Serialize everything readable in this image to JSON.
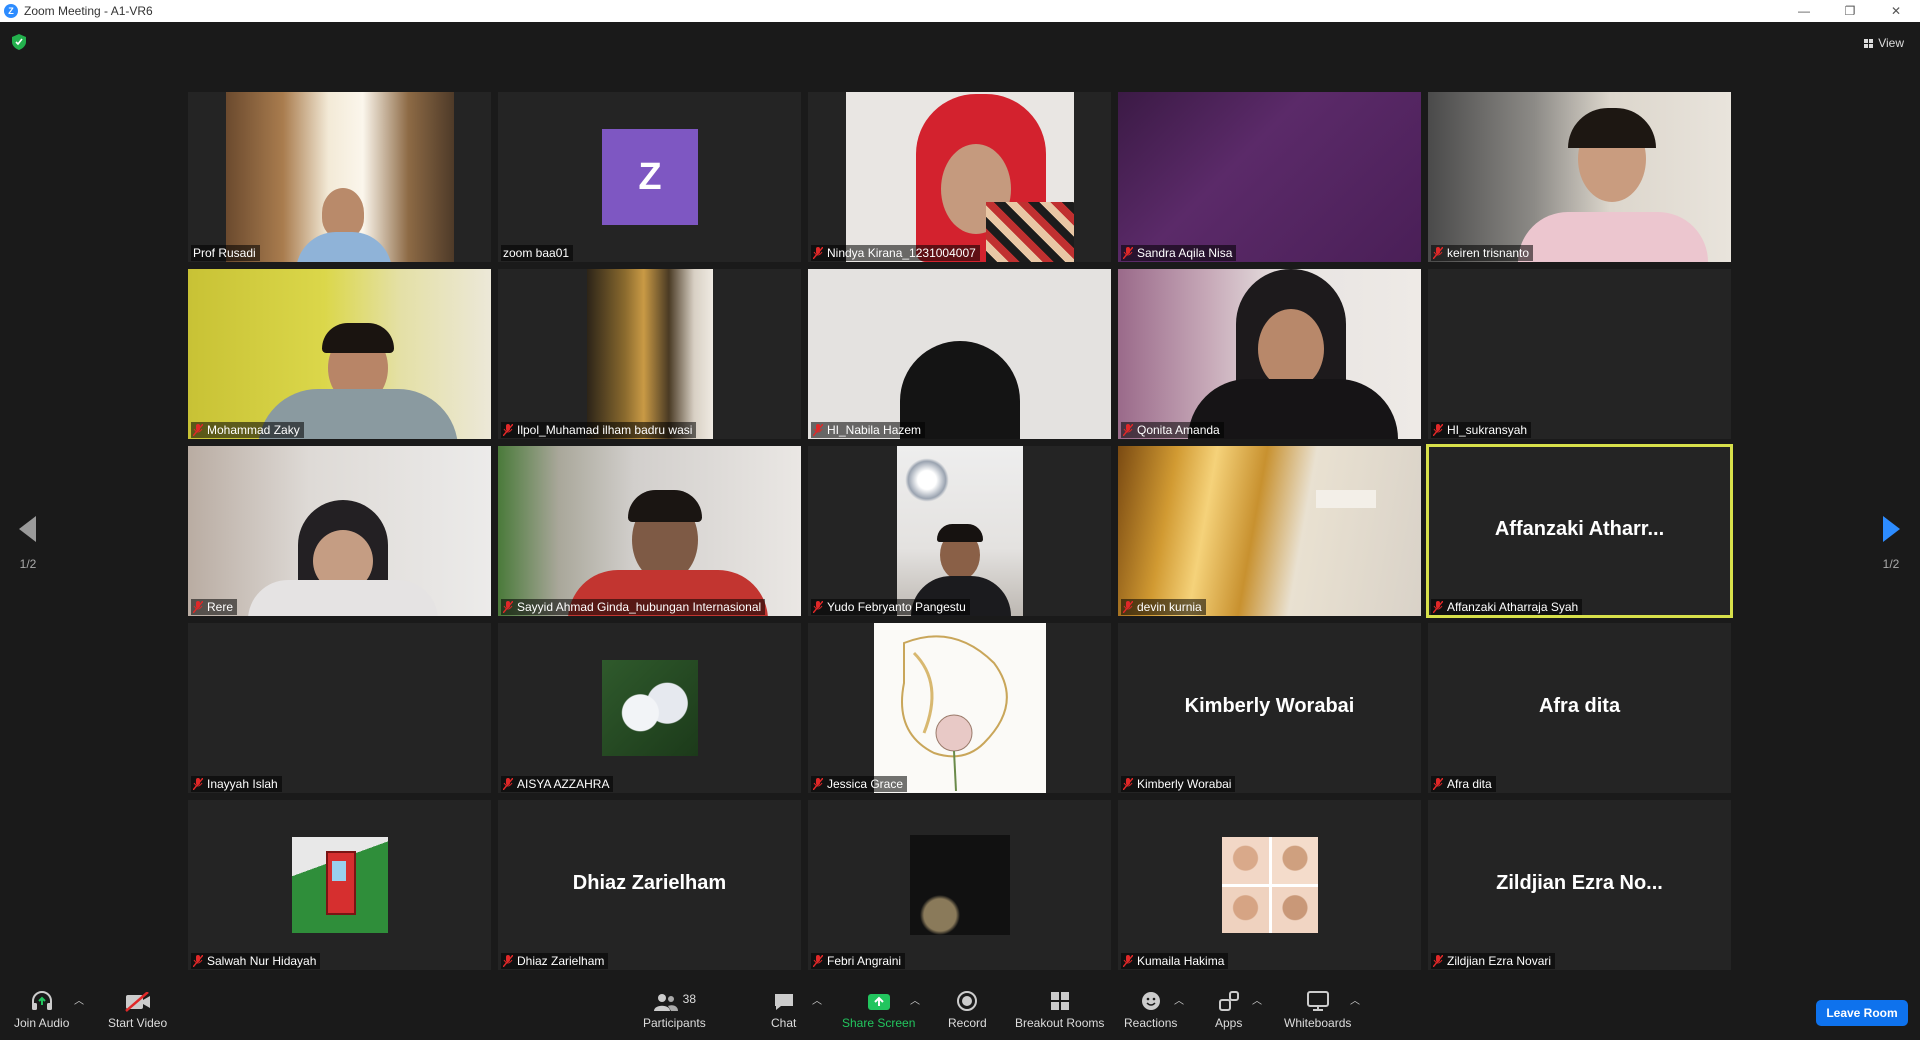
{
  "window": {
    "title": "Zoom Meeting - A1-VR6",
    "minimize": "—",
    "restore": "❐",
    "close": "✕"
  },
  "header": {
    "view_label": "View"
  },
  "paging": {
    "left": "1/2",
    "right": "1/2"
  },
  "participants": [
    {
      "name": "Prof Rusadi",
      "muted": false,
      "video": true
    },
    {
      "name": "zoom baa01",
      "muted": false,
      "video": false,
      "avatar_letter": "Z"
    },
    {
      "name": "Nindya Kirana_1231004007",
      "muted": true,
      "video": true
    },
    {
      "name": "Sandra Aqila Nisa",
      "muted": true,
      "video": true
    },
    {
      "name": "keiren trisnanto",
      "muted": true,
      "video": true
    },
    {
      "name": "Mohammad Zaky",
      "muted": true,
      "video": true
    },
    {
      "name": "Ilpol_Muhamad ilham badru wasi",
      "muted": true,
      "video": true
    },
    {
      "name": "HI_Nabila Hazem",
      "muted": true,
      "video": true
    },
    {
      "name": "Qonita Amanda",
      "muted": true,
      "video": true
    },
    {
      "name": "HI_sukransyah",
      "muted": true,
      "video": false
    },
    {
      "name": "Rere",
      "muted": true,
      "video": true
    },
    {
      "name": "Sayyid Ahmad Ginda_hubungan Internasional",
      "muted": true,
      "video": true
    },
    {
      "name": "Yudo Febryanto Pangestu",
      "muted": true,
      "video": true
    },
    {
      "name": "devin kurnia",
      "muted": true,
      "video": true
    },
    {
      "name": "Affanzaki Atharraja Syah",
      "muted": true,
      "video": false,
      "display_name": "Affanzaki  Atharr...",
      "active_speaker": true
    },
    {
      "name": "Inayyah Islah",
      "muted": true,
      "video": false
    },
    {
      "name": "AISYA AZZAHRA",
      "muted": true,
      "video": false,
      "profile_pic": "flowers"
    },
    {
      "name": "Jessica Grace",
      "muted": true,
      "video": true
    },
    {
      "name": "Kimberly Worabai",
      "muted": true,
      "video": false,
      "display_name": "Kimberly Worabai"
    },
    {
      "name": "Afra dita",
      "muted": true,
      "video": false,
      "display_name": "Afra dita"
    },
    {
      "name": "Salwah Nur Hidayah",
      "muted": true,
      "video": false,
      "profile_pic": "phone-booth"
    },
    {
      "name": "Dhiaz Zarielham",
      "muted": true,
      "video": false,
      "display_name": "Dhiaz Zarielham"
    },
    {
      "name": "Febri Angraini",
      "muted": true,
      "video": false,
      "profile_pic": "dark-photo"
    },
    {
      "name": "Kumaila Hakima",
      "muted": true,
      "video": false,
      "profile_pic": "collage"
    },
    {
      "name": "Zildjian Ezra Novari",
      "muted": true,
      "video": false,
      "display_name": "Zildjian  Ezra  No..."
    }
  ],
  "toolbar": {
    "join_audio": "Join Audio",
    "start_video": "Start Video",
    "participants": "Participants",
    "participants_count": "38",
    "chat": "Chat",
    "share_screen": "Share Screen",
    "record": "Record",
    "breakout_rooms": "Breakout Rooms",
    "reactions": "Reactions",
    "apps": "Apps",
    "whiteboards": "Whiteboards",
    "leave_room": "Leave Room"
  },
  "colors": {
    "share_green": "#22c55e",
    "leave_blue": "#0e72ed",
    "active_border": "#d7e04a",
    "muted_red": "#e02828",
    "avatar_purple": "#7e57c2"
  }
}
